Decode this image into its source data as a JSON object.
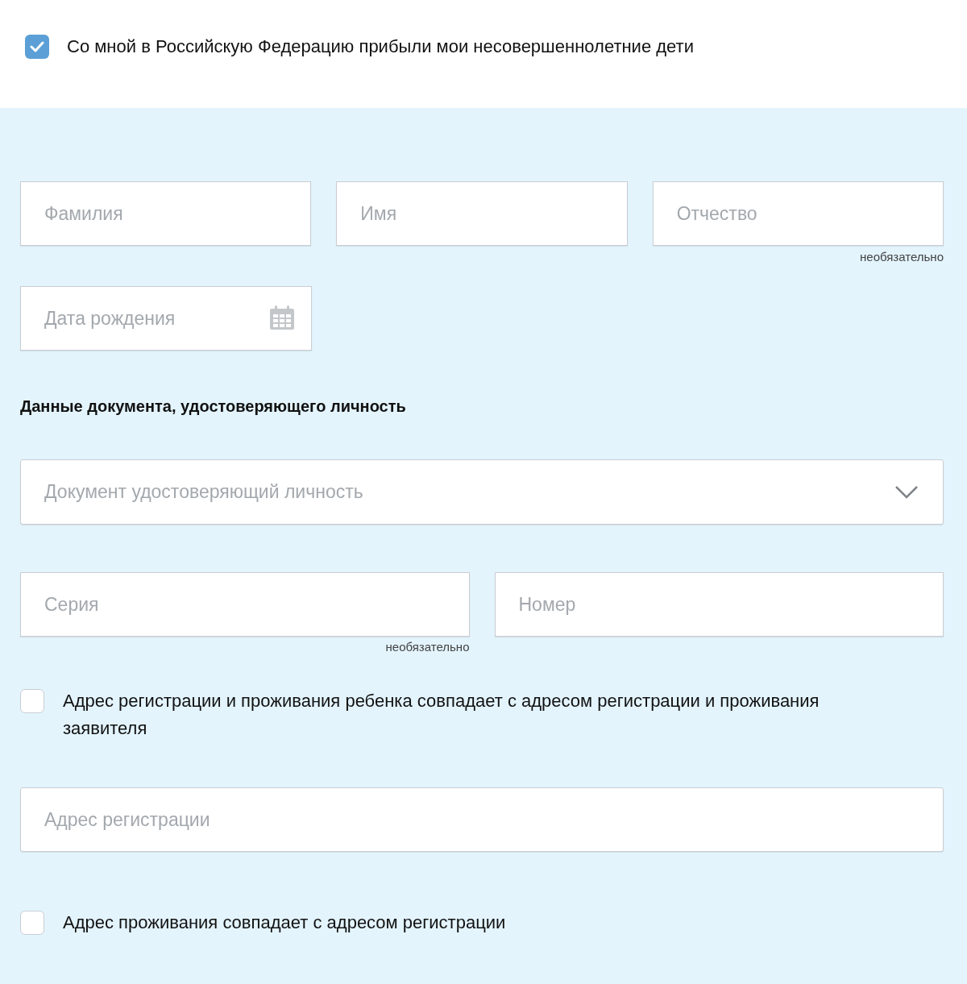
{
  "arrival_checkbox": {
    "label": "Со мной в Российскую Федерацию прибыли мои несовершеннолетние дети",
    "checked": true
  },
  "name_fields": [
    {
      "placeholder": "Фамилия"
    },
    {
      "placeholder": "Имя"
    },
    {
      "placeholder": "Отчество",
      "note": "необязательно"
    }
  ],
  "birth_date": {
    "placeholder": "Дата рождения"
  },
  "document_heading": "Данные документа, удостоверяющего личность",
  "document_select": {
    "placeholder": "Документ удостоверяющий личность"
  },
  "document_fields": [
    {
      "placeholder": "Серия",
      "note": "необязательно"
    },
    {
      "placeholder": "Номер"
    }
  ],
  "same_address_checkbox": {
    "label": "Адрес регистрации и проживания ребенка совпадает с адресом регистрации и проживания заявителя",
    "checked": false
  },
  "registration_address": {
    "placeholder": "Адрес регистрации"
  },
  "residence_checkbox": {
    "label": "Адрес проживания совпадает с адресом регистрации",
    "checked": false
  }
}
